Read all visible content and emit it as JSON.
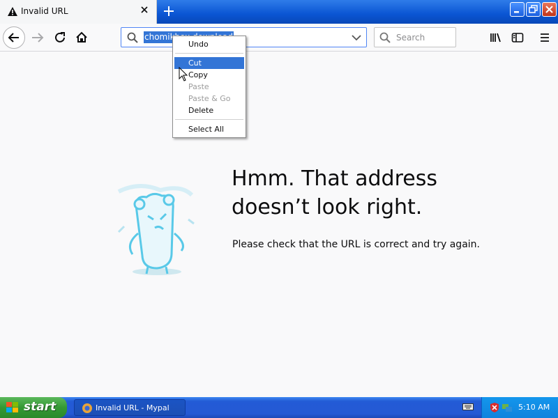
{
  "browser": {
    "tab": {
      "title": "Invalid URL",
      "icon": "warning-icon"
    },
    "url_selected_text": "chomikbox download",
    "search_placeholder": "Search"
  },
  "context_menu": {
    "items": [
      {
        "label": "Undo",
        "enabled": true,
        "highlighted": false
      },
      {
        "label": "Cut",
        "enabled": true,
        "highlighted": true
      },
      {
        "label": "Copy",
        "enabled": true,
        "highlighted": false
      },
      {
        "label": "Paste",
        "enabled": false,
        "highlighted": false
      },
      {
        "label": "Paste & Go",
        "enabled": false,
        "highlighted": false
      },
      {
        "label": "Delete",
        "enabled": true,
        "highlighted": false
      },
      {
        "label": "Select All",
        "enabled": true,
        "highlighted": false
      }
    ]
  },
  "error_page": {
    "title": "Hmm. That address doesn’t look right.",
    "message": "Please check that the URL is correct and try again."
  },
  "taskbar": {
    "start_label": "start",
    "task_label": "Invalid URL - Mypal",
    "clock": "5:10 AM"
  },
  "colors": {
    "accent": "#3375d6",
    "taskbar_blue": "#245edb",
    "start_green": "#349834"
  }
}
